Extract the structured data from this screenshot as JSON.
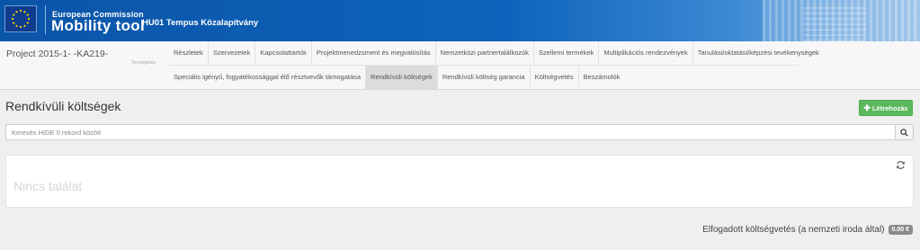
{
  "header": {
    "ec_label": "European Commission",
    "app_title": "Mobility tool",
    "org_title": "HU01 Tempus Közalapítvány"
  },
  "project": {
    "title": "Project 2015-1-        -KA219-",
    "subtitle": "Tervezgetés"
  },
  "nav": {
    "row1": [
      {
        "label": "Részletek"
      },
      {
        "label": "Szervezetek"
      },
      {
        "label": "Kapcsolattartók"
      },
      {
        "label": "Projektmenedzsment és megvalósítás"
      },
      {
        "label": "Nemzetközi partnertalálkozók"
      },
      {
        "label": "Szellemi termékek"
      },
      {
        "label": "Multiplikációs rendezvények"
      },
      {
        "label": "Tanulási/oktatási/képzési tevékenységek"
      }
    ],
    "row2": [
      {
        "label": "Speciális igényű, fogyatékossággal élő résztvevők támogatása"
      },
      {
        "label": "Rendkívüli költségek"
      },
      {
        "label": "Rendkívüli költség garancia"
      },
      {
        "label": "Költségvetés"
      },
      {
        "label": "Beszámolók"
      }
    ],
    "active": "Rendkívüli költségek"
  },
  "page": {
    "title": "Rendkívüli költségek",
    "create_label": "Létrehozás"
  },
  "search": {
    "placeholder": "Keresés HIDE 0 rekord között",
    "value": ""
  },
  "results": {
    "empty_text": "Nincs találat"
  },
  "footer": {
    "approved_label": "Elfogadott költségvetés (a nemzeti iroda által)",
    "approved_value": "0.00 €"
  },
  "colors": {
    "header_blue": "#0d63bb",
    "create_green": "#5cb85c",
    "badge_gray": "#8a8a8a"
  }
}
